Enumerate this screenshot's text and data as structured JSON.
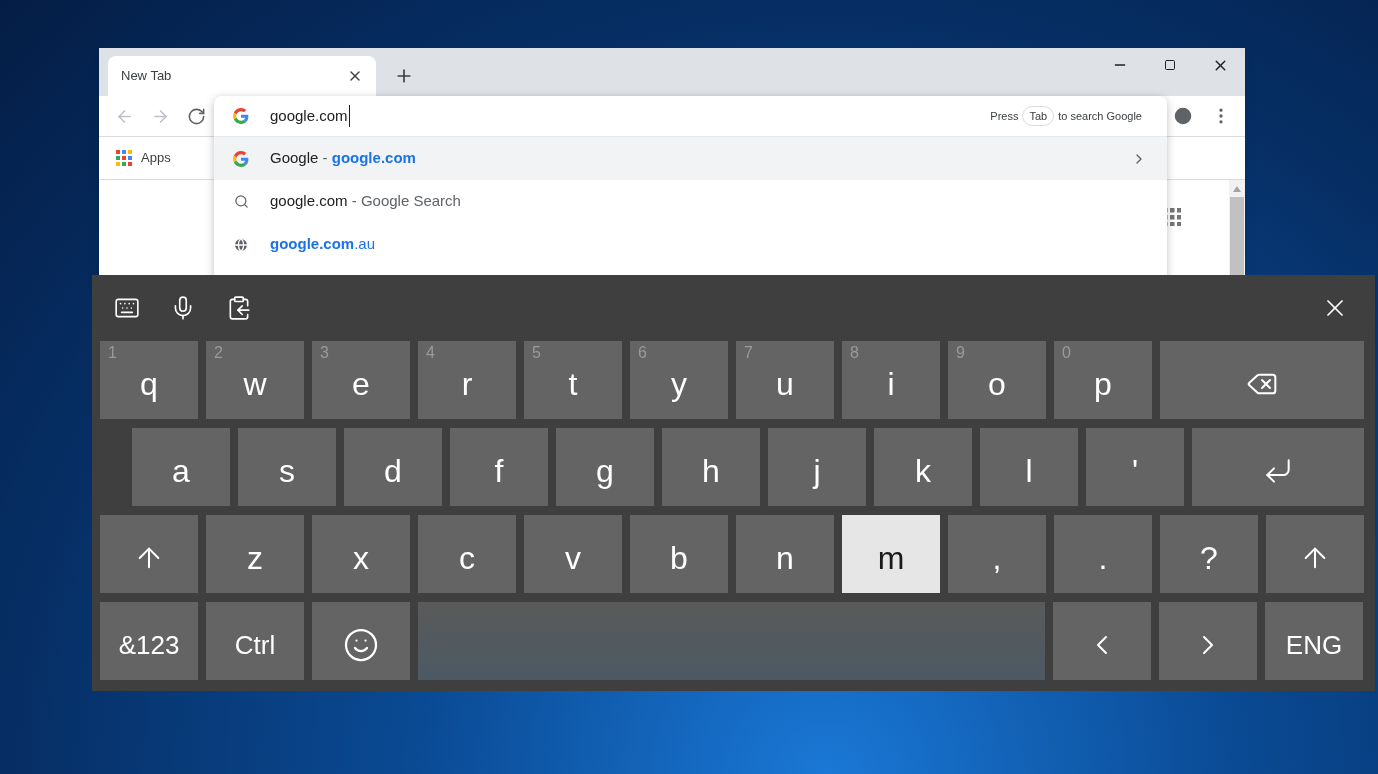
{
  "browser": {
    "tab": {
      "title": "New Tab"
    },
    "nav_buttons": [
      {
        "kind": "back",
        "disabled": true
      },
      {
        "kind": "forward",
        "disabled": true
      },
      {
        "kind": "reload",
        "disabled": false
      }
    ],
    "omnibox": {
      "value": "google.com",
      "hint_before": "Press",
      "hint_key": "Tab",
      "hint_after": "to search Google"
    },
    "suggestions": [
      {
        "kind": "site",
        "selected": true,
        "parts": [
          {
            "text": "Google",
            "kind": "plain"
          },
          {
            "text": " - ",
            "kind": "muted"
          },
          {
            "text": "google.com",
            "kind": "url_bold"
          }
        ]
      },
      {
        "kind": "search",
        "selected": false,
        "parts": [
          {
            "text": "google.com",
            "kind": "plain"
          },
          {
            "text": " - Google Search",
            "kind": "muted"
          }
        ]
      },
      {
        "kind": "history",
        "selected": false,
        "parts": [
          {
            "text": "google.com",
            "kind": "url_bold"
          },
          {
            "text": ".au",
            "kind": "url"
          }
        ]
      }
    ],
    "bookmarks": [
      {
        "label": "Apps"
      }
    ]
  },
  "keyboard": {
    "rows": [
      [
        {
          "kind": "char",
          "label": "q",
          "hint": "1",
          "pressed": false
        },
        {
          "kind": "char",
          "label": "w",
          "hint": "2",
          "pressed": false
        },
        {
          "kind": "char",
          "label": "e",
          "hint": "3",
          "pressed": false
        },
        {
          "kind": "char",
          "label": "r",
          "hint": "4",
          "pressed": false
        },
        {
          "kind": "char",
          "label": "t",
          "hint": "5",
          "pressed": false
        },
        {
          "kind": "char",
          "label": "y",
          "hint": "6",
          "pressed": false
        },
        {
          "kind": "char",
          "label": "u",
          "hint": "7",
          "pressed": false
        },
        {
          "kind": "char",
          "label": "i",
          "hint": "8",
          "pressed": false
        },
        {
          "kind": "char",
          "label": "o",
          "hint": "9",
          "pressed": false
        },
        {
          "kind": "char",
          "label": "p",
          "hint": "0",
          "pressed": false
        },
        {
          "kind": "backspace",
          "pressed": false
        }
      ],
      [
        {
          "kind": "char",
          "label": "a",
          "pressed": false
        },
        {
          "kind": "char",
          "label": "s",
          "pressed": false
        },
        {
          "kind": "char",
          "label": "d",
          "pressed": false
        },
        {
          "kind": "char",
          "label": "f",
          "pressed": false
        },
        {
          "kind": "char",
          "label": "g",
          "pressed": false
        },
        {
          "kind": "char",
          "label": "h",
          "pressed": false
        },
        {
          "kind": "char",
          "label": "j",
          "pressed": false
        },
        {
          "kind": "char",
          "label": "k",
          "pressed": false
        },
        {
          "kind": "char",
          "label": "l",
          "pressed": false
        },
        {
          "kind": "char",
          "label": "'",
          "pressed": false
        },
        {
          "kind": "enter",
          "pressed": false
        }
      ],
      [
        {
          "kind": "shift",
          "pressed": false
        },
        {
          "kind": "char",
          "label": "z",
          "pressed": false
        },
        {
          "kind": "char",
          "label": "x",
          "pressed": false
        },
        {
          "kind": "char",
          "label": "c",
          "pressed": false
        },
        {
          "kind": "char",
          "label": "v",
          "pressed": false
        },
        {
          "kind": "char",
          "label": "b",
          "pressed": false
        },
        {
          "kind": "char",
          "label": "n",
          "pressed": false
        },
        {
          "kind": "char",
          "label": "m",
          "pressed": true
        },
        {
          "kind": "char",
          "label": ",",
          "pressed": false
        },
        {
          "kind": "char",
          "label": ".",
          "pressed": false
        },
        {
          "kind": "char",
          "label": "?",
          "pressed": false
        },
        {
          "kind": "shift",
          "pressed": false
        }
      ],
      [
        {
          "kind": "text",
          "label": "&123",
          "pressed": false
        },
        {
          "kind": "text",
          "label": "Ctrl",
          "pressed": false
        },
        {
          "kind": "emoji",
          "pressed": false
        },
        {
          "kind": "space",
          "pressed": false
        },
        {
          "kind": "left",
          "pressed": false
        },
        {
          "kind": "right",
          "pressed": false
        },
        {
          "kind": "text",
          "label": "ENG",
          "pressed": false
        }
      ]
    ]
  }
}
